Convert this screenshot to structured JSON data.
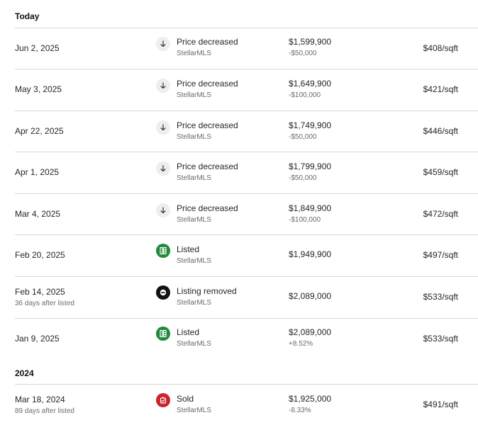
{
  "sections": [
    {
      "header": "Today"
    },
    {
      "header": "2024"
    }
  ],
  "rows": [
    {
      "date": "Jun 2, 2025",
      "date_sub": "",
      "icon": "arrow-down-icon",
      "event": "Price decreased",
      "source": "StellarMLS",
      "price": "$1,599,900",
      "change": "-$50,000",
      "sqft": "$408/sqft"
    },
    {
      "date": "May 3, 2025",
      "date_sub": "",
      "icon": "arrow-down-icon",
      "event": "Price decreased",
      "source": "StellarMLS",
      "price": "$1,649,900",
      "change": "-$100,000",
      "sqft": "$421/sqft"
    },
    {
      "date": "Apr 22, 2025",
      "date_sub": "",
      "icon": "arrow-down-icon",
      "event": "Price decreased",
      "source": "StellarMLS",
      "price": "$1,749,900",
      "change": "-$50,000",
      "sqft": "$446/sqft"
    },
    {
      "date": "Apr 1, 2025",
      "date_sub": "",
      "icon": "arrow-down-icon",
      "event": "Price decreased",
      "source": "StellarMLS",
      "price": "$1,799,900",
      "change": "-$50,000",
      "sqft": "$459/sqft"
    },
    {
      "date": "Mar 4, 2025",
      "date_sub": "",
      "icon": "arrow-down-icon",
      "event": "Price decreased",
      "source": "StellarMLS",
      "price": "$1,849,900",
      "change": "-$100,000",
      "sqft": "$472/sqft"
    },
    {
      "date": "Feb 20, 2025",
      "date_sub": "",
      "icon": "listed-tag-icon",
      "event": "Listed",
      "source": "StellarMLS",
      "price": "$1,949,900",
      "change": "",
      "sqft": "$497/sqft"
    },
    {
      "date": "Feb 14, 2025",
      "date_sub": "36 days after listed",
      "icon": "removed-minus-icon",
      "event": "Listing removed",
      "source": "StellarMLS",
      "price": "$2,089,000",
      "change": "",
      "sqft": "$533/sqft"
    },
    {
      "date": "Jan 9, 2025",
      "date_sub": "",
      "icon": "listed-tag-icon",
      "event": "Listed",
      "source": "StellarMLS",
      "price": "$2,089,000",
      "change": "+8.52%",
      "sqft": "$533/sqft"
    },
    {
      "date": "Mar 18, 2024",
      "date_sub": "89 days after listed",
      "icon": "sold-tag-icon",
      "event": "Sold",
      "source": "StellarMLS",
      "price": "$1,925,000",
      "change": "-8.33%",
      "sqft": "$491/sqft"
    }
  ],
  "colors": {
    "listed": "#1f8a3a",
    "removed": "#111111",
    "sold": "#c8262c",
    "arrow_bg": "#eeeeee",
    "divider": "#d6d6d6"
  }
}
